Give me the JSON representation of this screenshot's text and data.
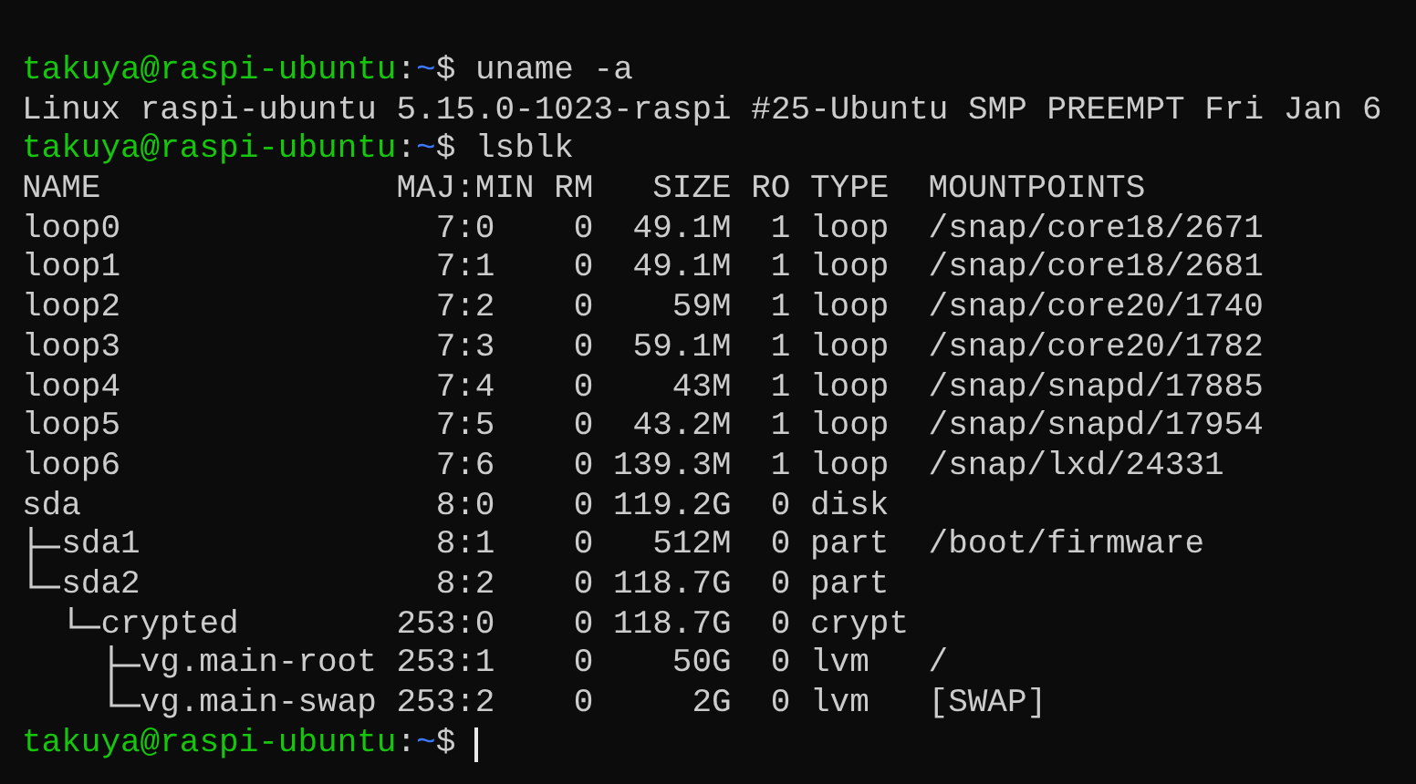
{
  "terminal": {
    "lines": [
      {
        "kind": "prompt",
        "user_host": "takuya@raspi-ubuntu",
        "separator": ":",
        "path": "~",
        "symbol": "$",
        "command": "uname -a",
        "cursor": false
      },
      {
        "kind": "output",
        "text": "Linux raspi-ubuntu 5.15.0-1023-raspi #25-Ubuntu SMP PREEMPT Fri Jan 6"
      },
      {
        "kind": "prompt",
        "user_host": "takuya@raspi-ubuntu",
        "separator": ":",
        "path": "~",
        "symbol": "$",
        "command": "lsblk",
        "cursor": false
      },
      {
        "kind": "table",
        "columns": [
          "NAME",
          "MAJ:MIN",
          "RM",
          "SIZE",
          "RO",
          "TYPE",
          "MOUNTPOINTS"
        ],
        "rows": [
          {
            "cells": [
              "loop0",
              "7:0",
              "0",
              "49.1M",
              "1",
              "loop",
              "/snap/core18/2671"
            ]
          },
          {
            "cells": [
              "loop1",
              "7:1",
              "0",
              "49.1M",
              "1",
              "loop",
              "/snap/core18/2681"
            ]
          },
          {
            "cells": [
              "loop2",
              "7:2",
              "0",
              "59M",
              "1",
              "loop",
              "/snap/core20/1740"
            ]
          },
          {
            "cells": [
              "loop3",
              "7:3",
              "0",
              "59.1M",
              "1",
              "loop",
              "/snap/core20/1782"
            ]
          },
          {
            "cells": [
              "loop4",
              "7:4",
              "0",
              "43M",
              "1",
              "loop",
              "/snap/snapd/17885"
            ]
          },
          {
            "cells": [
              "loop5",
              "7:5",
              "0",
              "43.2M",
              "1",
              "loop",
              "/snap/snapd/17954"
            ]
          },
          {
            "cells": [
              "loop6",
              "7:6",
              "0",
              "139.3M",
              "1",
              "loop",
              "/snap/lxd/24331"
            ]
          },
          {
            "cells": [
              "sda",
              "8:0",
              "0",
              "119.2G",
              "0",
              "disk"
            ],
            "children": [
              {
                "cells": [
                  "sda1",
                  "8:1",
                  "0",
                  "512M",
                  "0",
                  "part",
                  "/boot/firmware"
                ]
              },
              {
                "cells": [
                  "sda2",
                  "8:2",
                  "0",
                  "118.7G",
                  "0",
                  "part"
                ],
                "children": [
                  {
                    "cells": [
                      "crypted",
                      "253:0",
                      "0",
                      "118.7G",
                      "0",
                      "crypt"
                    ],
                    "children": [
                      {
                        "cells": [
                          "vg.main-root",
                          "253:1",
                          "0",
                          "50G",
                          "0",
                          "lvm",
                          "/"
                        ]
                      },
                      {
                        "cells": [
                          "vg.main-swap",
                          "253:2",
                          "0",
                          "2G",
                          "0",
                          "lvm",
                          "[SWAP]"
                        ]
                      }
                    ]
                  }
                ]
              }
            ]
          }
        ]
      },
      {
        "kind": "prompt",
        "user_host": "takuya@raspi-ubuntu",
        "separator": ":",
        "path": "~",
        "symbol": "$",
        "cursor": true
      }
    ]
  }
}
